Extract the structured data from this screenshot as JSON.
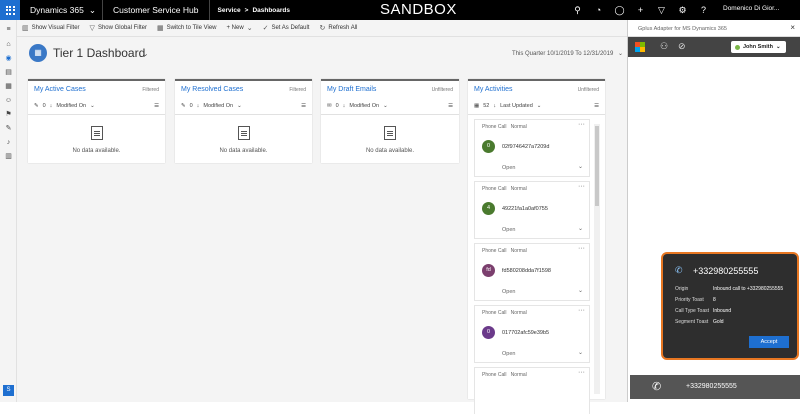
{
  "topbar": {
    "brand": "Dynamics 365",
    "app_name": "Customer Service Hub",
    "crumb_area": "Service",
    "crumb_sep": ">",
    "crumb_page": "Dashboards",
    "environment": "SANDBOX",
    "user_name": "Domenico Di Gior..."
  },
  "commands": {
    "show_visual_filter": "Show Visual Filter",
    "show_global_filter": "Show Global Filter",
    "switch_tile": "Switch to Tile View",
    "new": "+ New",
    "set_default": "Set As Default",
    "refresh_all": "Refresh All"
  },
  "dashboard": {
    "title": "Tier 1 Dashboard",
    "period": "This Quarter 10/1/2019 To 12/31/2019"
  },
  "cards": [
    {
      "title": "My Active Cases",
      "filter": "Filtered",
      "count": "0",
      "sort": "Modified On",
      "empty": "No data available."
    },
    {
      "title": "My Resolved Cases",
      "filter": "Filtered",
      "count": "0",
      "sort": "Modified On",
      "empty": "No data available."
    },
    {
      "title": "My Draft Emails",
      "filter": "Unfiltered",
      "count": "0",
      "sort": "Modified On",
      "empty": "No data available."
    }
  ],
  "activities": {
    "title": "My Activities",
    "filter": "Unfiltered",
    "count": "52",
    "sort": "Last Updated",
    "items": [
      {
        "type": "Phone Call",
        "priority": "Normal",
        "avatar": "0",
        "avatar_color": "#4a7a2e",
        "subject": "02f9746427a7209d",
        "status": "Open"
      },
      {
        "type": "Phone Call",
        "priority": "Normal",
        "avatar": "4",
        "avatar_color": "#4a7a2e",
        "subject": "49221fa1a0af0755",
        "status": "Open"
      },
      {
        "type": "Phone Call",
        "priority": "Normal",
        "avatar": "fd",
        "avatar_color": "#7b3f6e",
        "subject": "fd580208dda7f1598",
        "status": "Open"
      },
      {
        "type": "Phone Call",
        "priority": "Normal",
        "avatar": "0",
        "avatar_color": "#6b3a8a",
        "subject": "017702afc59e39b5",
        "status": "Open"
      },
      {
        "type": "Phone Call",
        "priority": "Normal",
        "avatar": "",
        "avatar_color": "#777777",
        "subject": "",
        "status": ""
      }
    ]
  },
  "panel": {
    "title": "Gplus Adapter for MS Dynamics 365",
    "agent": "John Smith",
    "agent_status_color": "#7ab648"
  },
  "toast": {
    "number": "+332980255555",
    "rows": [
      {
        "key": "Origin",
        "value": "Inbound call to +332980255555"
      },
      {
        "key": "Priority Toast",
        "value": "8"
      },
      {
        "key": "Call Type Toast",
        "value": "Inbound"
      },
      {
        "key": "Segment Toast",
        "value": "Gold"
      }
    ],
    "accept": "Accept"
  },
  "call_bar": {
    "number": "+332980255555"
  },
  "colors": {
    "accent": "#1e6fd0",
    "toast_border": "#e87722"
  }
}
